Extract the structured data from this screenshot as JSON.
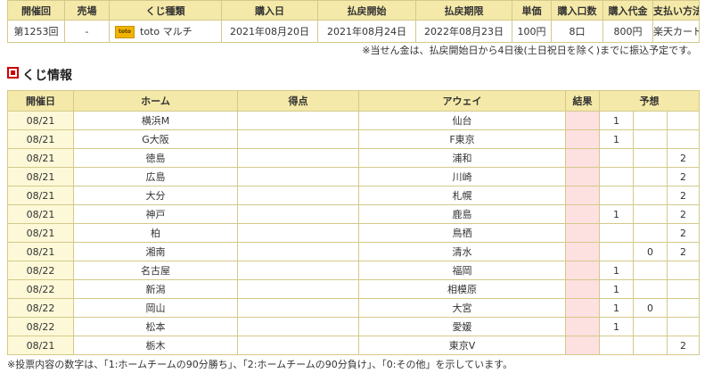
{
  "summary": {
    "headers": [
      "開催回",
      "売場",
      "くじ種類",
      "購入日",
      "払戻開始",
      "払戻期限",
      "単価",
      "購入口数",
      "購入代金",
      "支払い方法"
    ],
    "row": {
      "kaisai": "第1253回",
      "uriba": "-",
      "kuji_logo_text": "toto",
      "kuji_type": "toto マルチ",
      "purchase_date": "2021年08月20日",
      "payout_start": "2021年08月24日",
      "payout_deadline": "2022年08月23日",
      "unit_price": "100円",
      "quantity": "8口",
      "total": "800円",
      "payment": "楽天カード"
    },
    "notice": "※当せん金は、払戻開始日から4日後(土日祝日を除く)までに振込予定です。"
  },
  "section_title": "くじ情報",
  "detail": {
    "headers": {
      "date": "開催日",
      "home": "ホーム",
      "score": "得点",
      "away": "アウェイ",
      "result": "結果",
      "prediction": "予想"
    },
    "rows": [
      {
        "date": "08/21",
        "home": "横浜M",
        "away": "仙台",
        "p1": "1",
        "p0": "",
        "p2": ""
      },
      {
        "date": "08/21",
        "home": "G大阪",
        "away": "F東京",
        "p1": "1",
        "p0": "",
        "p2": ""
      },
      {
        "date": "08/21",
        "home": "徳島",
        "away": "浦和",
        "p1": "",
        "p0": "",
        "p2": "2"
      },
      {
        "date": "08/21",
        "home": "広島",
        "away": "川崎",
        "p1": "",
        "p0": "",
        "p2": "2"
      },
      {
        "date": "08/21",
        "home": "大分",
        "away": "札幌",
        "p1": "",
        "p0": "",
        "p2": "2"
      },
      {
        "date": "08/21",
        "home": "神戸",
        "away": "鹿島",
        "p1": "1",
        "p0": "",
        "p2": "2"
      },
      {
        "date": "08/21",
        "home": "柏",
        "away": "鳥栖",
        "p1": "",
        "p0": "",
        "p2": "2"
      },
      {
        "date": "08/21",
        "home": "湘南",
        "away": "清水",
        "p1": "",
        "p0": "0",
        "p2": "2"
      },
      {
        "date": "08/22",
        "home": "名古屋",
        "away": "福岡",
        "p1": "1",
        "p0": "",
        "p2": ""
      },
      {
        "date": "08/22",
        "home": "新潟",
        "away": "相模原",
        "p1": "1",
        "p0": "",
        "p2": ""
      },
      {
        "date": "08/22",
        "home": "岡山",
        "away": "大宮",
        "p1": "1",
        "p0": "0",
        "p2": ""
      },
      {
        "date": "08/22",
        "home": "松本",
        "away": "愛媛",
        "p1": "1",
        "p0": "",
        "p2": ""
      },
      {
        "date": "08/21",
        "home": "栃木",
        "away": "東京V",
        "p1": "",
        "p0": "",
        "p2": "2"
      }
    ]
  },
  "footer_notice": "※投票内容の数字は、「1:ホームチームの90分勝ち」、「2:ホームチームの90分負け」、「0:その他」を示しています。",
  "colors": {
    "header_bg": "#f4e9a8",
    "border": "#d4c98a",
    "date_bg": "#fdf9d8",
    "result_bg": "#fde0e0",
    "section_marker": "#cc0000"
  }
}
